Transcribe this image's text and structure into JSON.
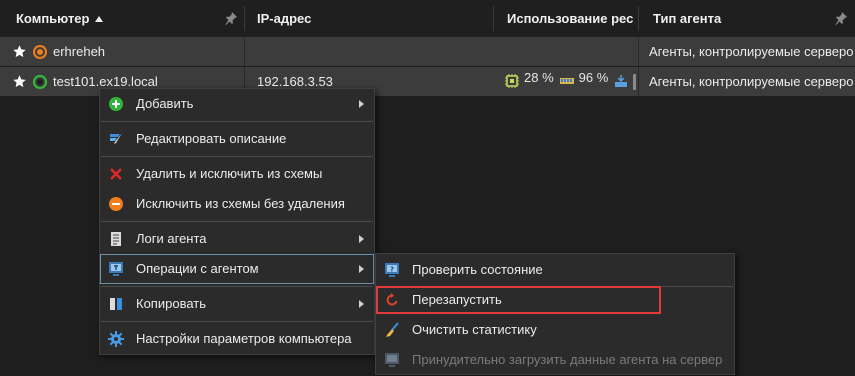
{
  "header": {
    "computer": "Компьютер",
    "ip": "IP-адрес",
    "usage": "Использование ресурсов",
    "agent_type": "Тип агента"
  },
  "rows": [
    {
      "name": "erhreheh",
      "ip": "",
      "cpu": "",
      "ram": "",
      "disk": "",
      "agent_type": "Агенты, контролируемые сервером",
      "status_color": "#f07d1e"
    },
    {
      "name": "test101.ex19.local",
      "ip": "192.168.3.53",
      "cpu": "28 %",
      "ram": "96 %",
      "disk": "4",
      "agent_type": "Агенты, контролируемые сервером",
      "status_color": "#2fbf3a"
    }
  ],
  "context_menu": {
    "items": [
      {
        "label": "Добавить",
        "icon": "plus-circle-icon",
        "submenu": true
      },
      {
        "label": "Редактировать описание",
        "icon": "edit-icon",
        "submenu": false
      },
      {
        "label": "Удалить и исключить из схемы",
        "icon": "x-icon",
        "submenu": false
      },
      {
        "label": "Исключить из схемы без удаления",
        "icon": "minus-circle-icon",
        "submenu": false
      },
      {
        "label": "Логи агента",
        "icon": "log-icon",
        "submenu": true
      },
      {
        "label": "Операции с агентом",
        "icon": "agent-ops-icon",
        "submenu": true
      },
      {
        "label": "Копировать",
        "icon": "copy-icon",
        "submenu": true
      },
      {
        "label": "Настройки параметров компьютера",
        "icon": "gear-icon",
        "submenu": false
      }
    ]
  },
  "submenu": {
    "items": [
      {
        "label": "Проверить состояние",
        "icon": "check-status-icon",
        "disabled": false
      },
      {
        "label": "Перезапустить",
        "icon": "restart-icon",
        "disabled": false
      },
      {
        "label": "Очистить статистику",
        "icon": "broom-icon",
        "disabled": false
      },
      {
        "label": "Принудительно загрузить данные агента на сервер",
        "icon": "upload-icon",
        "disabled": true
      }
    ]
  },
  "colors": {
    "highlight": "#e03a3a",
    "row_bg": "#3c3c3c",
    "menu_bg": "#2b2b2b"
  }
}
